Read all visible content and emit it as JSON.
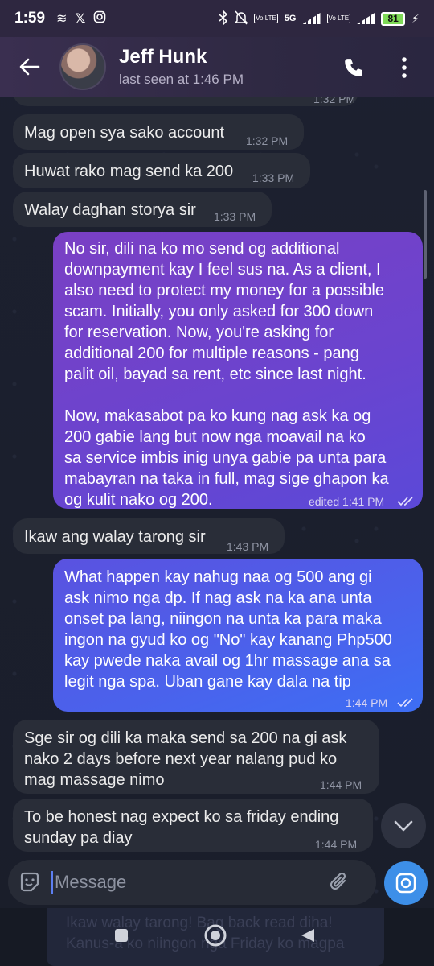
{
  "status_bar": {
    "time": "1:59",
    "battery": "81",
    "net": "5G",
    "vo1": "Vo LTE",
    "vo2": "Vo LTE"
  },
  "header": {
    "name": "Jeff Hunk",
    "status": "last seen at 1:46 PM"
  },
  "messages": [
    {
      "dir": "in",
      "text": "Mag open sya sako account",
      "time": "1:32 PM"
    },
    {
      "dir": "in",
      "text": "Huwat rako mag send ka 200",
      "time": "1:33 PM"
    },
    {
      "dir": "in",
      "text": "Walay daghan storya sir",
      "time": "1:33 PM"
    },
    {
      "dir": "out",
      "lines": [
        "No sir, dili na ko mo send og additional",
        "downpayment kay I feel sus na. As a client, I",
        "also need to protect my money for a possible",
        "scam. Initially, you only asked for 300 down",
        "for reservation. Now, you're asking for",
        "additional 200 for multiple reasons - pang",
        "palit oil, bayad sa rent, etc since last night.",
        "",
        "Now, makasabot pa ko kung nag ask ka og",
        "200 gabie lang but now nga moavail na ko",
        "sa service imbis inig unya gabie pa unta para",
        "mabayran na taka in full, mag sige ghapon ka",
        "og kulit nako og 200."
      ],
      "time": "edited 1:41 PM"
    },
    {
      "dir": "in",
      "text": "Ikaw ang walay tarong sir",
      "time": "1:43 PM"
    },
    {
      "dir": "out",
      "lines": [
        "What happen kay nahug naa og 500 ang gi",
        "ask nimo nga dp. If nag ask na ka ana unta",
        "onset pa lang, niingon na unta ka para maka",
        "ingon na gyud ko og \"No\" kay kanang Php500",
        "kay pwede naka avail og 1hr massage ana sa",
        "legit nga spa. Uban gane kay dala na tip"
      ],
      "time": "1:44 PM"
    },
    {
      "dir": "in",
      "lines": [
        "Sge sir og dili ka maka send sa 200 na gi ask",
        "nako 2 days before next year nalang pud ko",
        "mag massage nimo"
      ],
      "time": "1:44 PM"
    },
    {
      "dir": "in",
      "lines": [
        "To be honest nag expect ko sa friday ending",
        "sunday pa diay"
      ],
      "time": "1:44 PM"
    }
  ],
  "partial_top_time": "1:32 PM",
  "input": {
    "placeholder": "Message"
  },
  "ghost_lines": [
    "Ikaw walay tarong! Bag back read diha!",
    "Kanus-a ko niingon nga Friday ko magpa"
  ]
}
